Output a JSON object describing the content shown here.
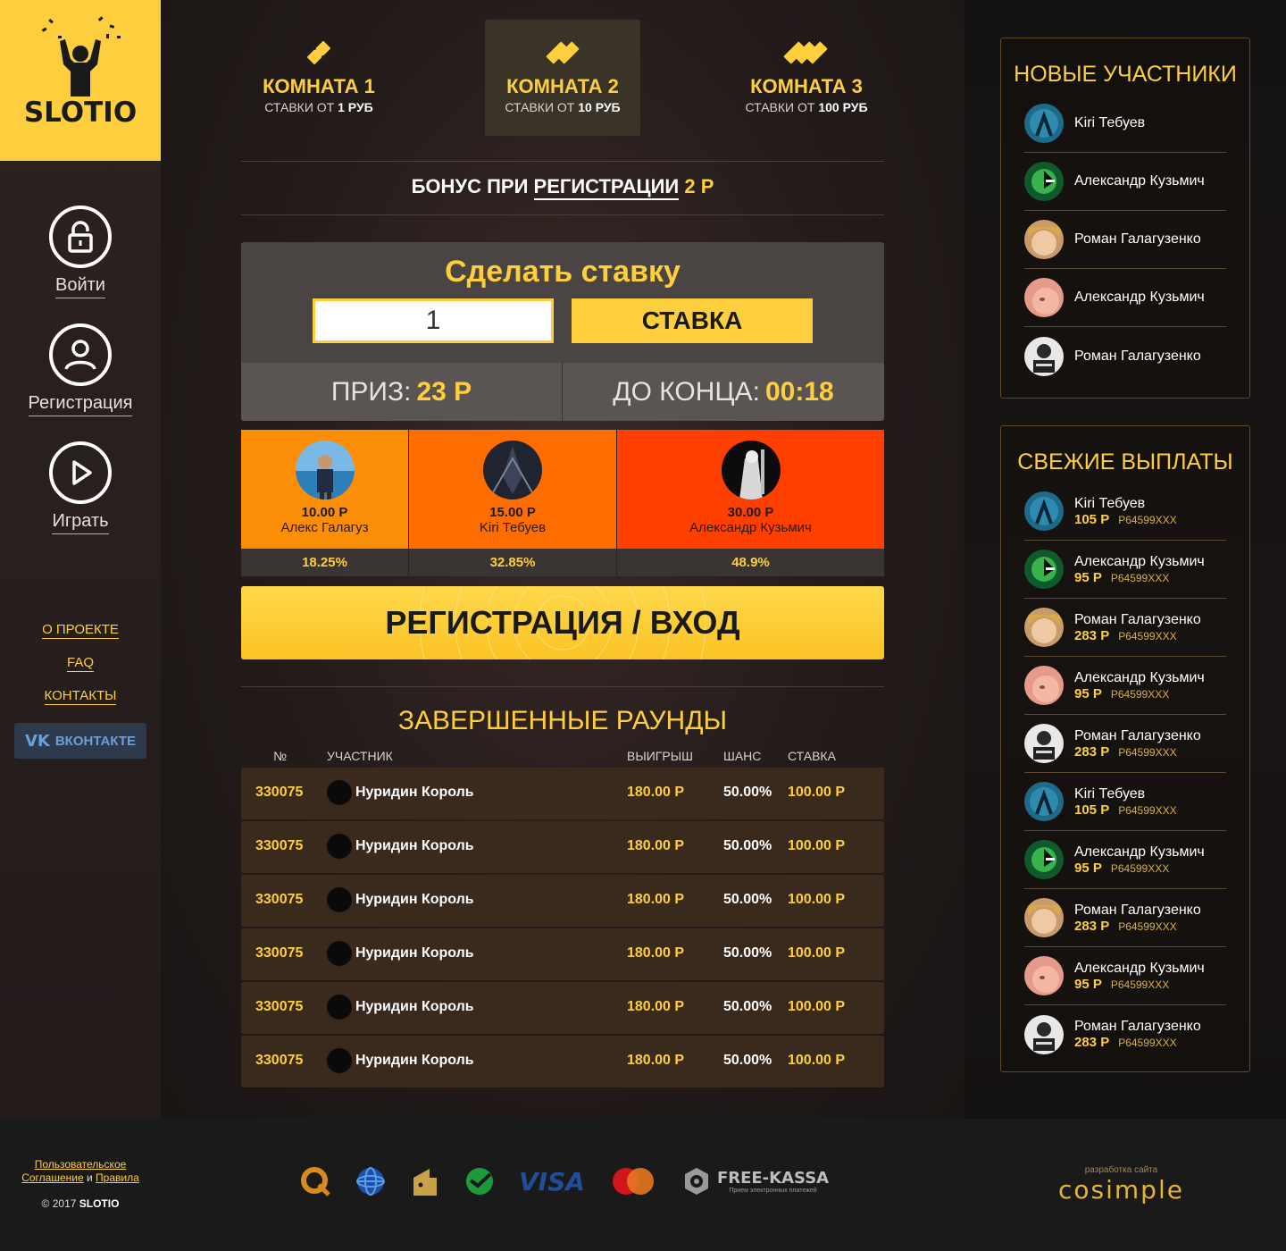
{
  "brand": {
    "name": "SLOTIO",
    "accent": "#fdcf3e"
  },
  "sidebar": {
    "nav": [
      {
        "label": "Войти",
        "icon": "lock-icon"
      },
      {
        "label": "Регистрация",
        "icon": "user-icon"
      },
      {
        "label": "Играть",
        "icon": "play-icon"
      }
    ],
    "links": [
      "О ПРОЕКТЕ",
      "FAQ",
      "КОНТАКТЫ"
    ],
    "vk": {
      "logo": "VK",
      "label": "ВКОНТАКТЕ"
    }
  },
  "rooms": [
    {
      "title": "КОМНАТА 1",
      "sub_prefix": "СТАВКИ ОТ",
      "sub_value": "1 РУБ"
    },
    {
      "title": "КОМНАТА 2",
      "sub_prefix": "СТАВКИ ОТ",
      "sub_value": "10 РУБ"
    },
    {
      "title": "КОМНАТА 3",
      "sub_prefix": "СТАВКИ ОТ",
      "sub_value": "100 РУБ"
    }
  ],
  "bonus": {
    "prefix": "БОНУС ПРИ",
    "link": "РЕГИСТРАЦИИ",
    "amount": "2 Р"
  },
  "bet": {
    "title": "Сделать ставку",
    "input_value": "1",
    "button": "СТАВКА",
    "prize_label": "ПРИЗ:",
    "prize_value": "23 Р",
    "time_label": "ДО КОНЦА:",
    "time_value": "00:18"
  },
  "players": [
    {
      "amount": "10.00 Р",
      "name": "Алекс Галагуз",
      "pct": "18.25%"
    },
    {
      "amount": "15.00 Р",
      "name": "Kiri Тебуев",
      "pct": "32.85%"
    },
    {
      "amount": "30.00 Р",
      "name": "Александр Кузьмич",
      "pct": "48.9%"
    }
  ],
  "register_button": "РЕГИСТРАЦИЯ / ВХОД",
  "rounds": {
    "title": "ЗАВЕРШЕННЫЕ РАУНДЫ",
    "headers": [
      "№",
      "УЧАСТНИК",
      "ВЫИГРЫШ",
      "ШАНС",
      "СТАВКА"
    ],
    "rows": [
      {
        "num": "330075",
        "name": "Нуридин Король",
        "win": "180.00 Р",
        "chance": "50.00%",
        "bet": "100.00 Р"
      },
      {
        "num": "330075",
        "name": "Нуридин Король",
        "win": "180.00 Р",
        "chance": "50.00%",
        "bet": "100.00 Р"
      },
      {
        "num": "330075",
        "name": "Нуридин Король",
        "win": "180.00 Р",
        "chance": "50.00%",
        "bet": "100.00 Р"
      },
      {
        "num": "330075",
        "name": "Нуридин Король",
        "win": "180.00 Р",
        "chance": "50.00%",
        "bet": "100.00 Р"
      },
      {
        "num": "330075",
        "name": "Нуридин Король",
        "win": "180.00 Р",
        "chance": "50.00%",
        "bet": "100.00 Р"
      },
      {
        "num": "330075",
        "name": "Нуридин Король",
        "win": "180.00 Р",
        "chance": "50.00%",
        "bet": "100.00 Р"
      }
    ]
  },
  "new_members": {
    "title": "НОВЫЕ УЧАСТНИКИ",
    "items": [
      {
        "name": "Kiri Тебуев"
      },
      {
        "name": "Александр Кузьмич"
      },
      {
        "name": "Роман Галагузенко"
      },
      {
        "name": "Александр Кузьмич"
      },
      {
        "name": "Роман Галагузенко"
      }
    ]
  },
  "payouts": {
    "title": "СВЕЖИЕ ВЫПЛАТЫ",
    "items": [
      {
        "name": "Kiri Тебуев",
        "amount": "105 Р",
        "account": "P64599XXX"
      },
      {
        "name": "Александр Кузьмич",
        "amount": "95 Р",
        "account": "P64599XXX"
      },
      {
        "name": "Роман Галагузенко",
        "amount": "283 Р",
        "account": "P64599XXX"
      },
      {
        "name": "Александр Кузьмич",
        "amount": "95 Р",
        "account": "P64599XXX"
      },
      {
        "name": "Роман Галагузенко",
        "amount": "283 Р",
        "account": "P64599XXX"
      },
      {
        "name": "Kiri Тебуев",
        "amount": "105 Р",
        "account": "P64599XXX"
      },
      {
        "name": "Александр Кузьмич",
        "amount": "95 Р",
        "account": "P64599XXX"
      },
      {
        "name": "Роман Галагузенко",
        "amount": "283 Р",
        "account": "P64599XXX"
      },
      {
        "name": "Александр Кузьмич",
        "amount": "95 Р",
        "account": "P64599XXX"
      },
      {
        "name": "Роман Галагузенко",
        "amount": "283 Р",
        "account": "P64599XXX"
      }
    ]
  },
  "footer": {
    "agreement_1": "Пользовательское",
    "agreement_2": "Соглашение",
    "and": "и",
    "rules": "Правила",
    "copyright": "© 2017",
    "brand": "SLOTIO",
    "payments": [
      "qiwi-icon",
      "webmoney-icon",
      "yandex-money-icon",
      "sberbank-icon",
      "visa-icon",
      "mastercard-icon",
      "free-kassa-icon"
    ],
    "visa": "VISA",
    "freekassa": "FREE-KASSA",
    "freekassa_sub": "Прием электронных платежей",
    "dev_small": "разработка сайта",
    "dev_logo": "cosimple"
  }
}
